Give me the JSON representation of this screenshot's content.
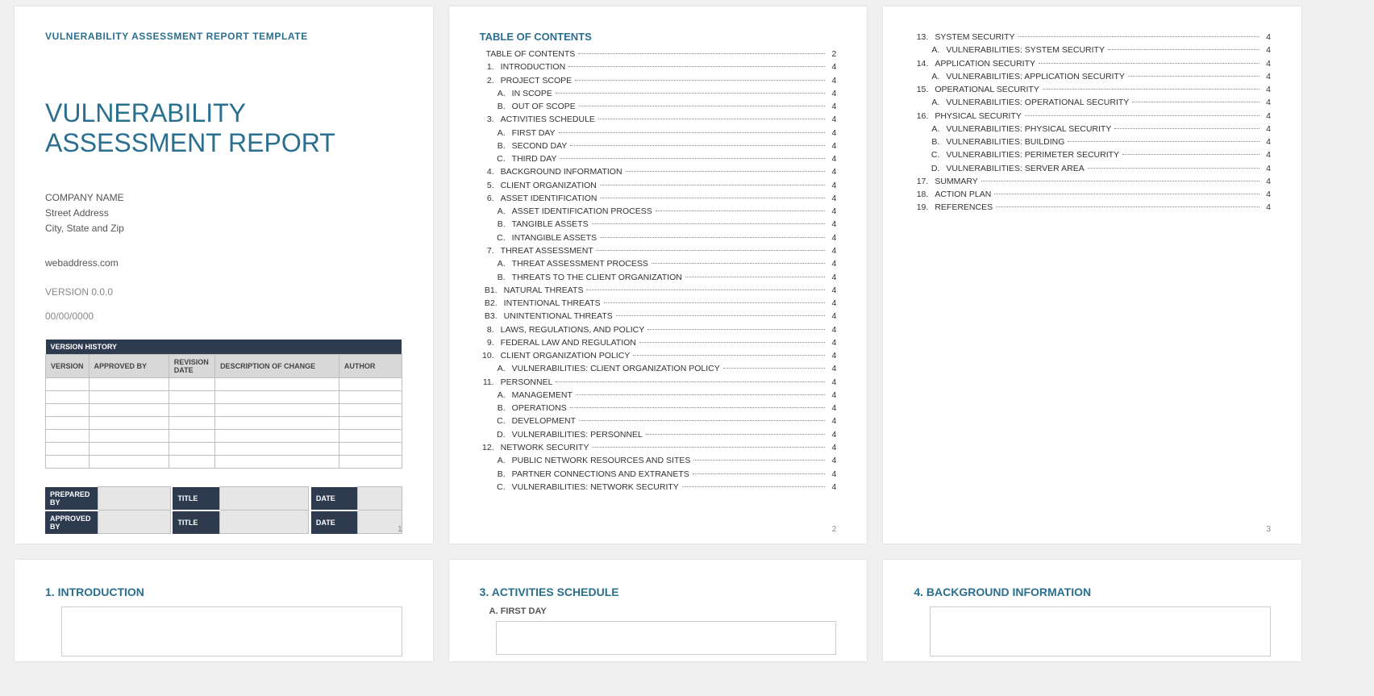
{
  "header": {
    "template_label": "VULNERABILITY ASSESSMENT REPORT TEMPLATE"
  },
  "title_page": {
    "title_line1": "VULNERABILITY",
    "title_line2": "ASSESSMENT REPORT",
    "company_name": "COMPANY NAME",
    "street": "Street Address",
    "city": "City, State and Zip",
    "web": "webaddress.com",
    "version": "VERSION 0.0.0",
    "date": "00/00/0000",
    "version_history": {
      "title": "VERSION HISTORY",
      "cols": [
        "VERSION",
        "APPROVED BY",
        "REVISION DATE",
        "DESCRIPTION OF CHANGE",
        "AUTHOR"
      ]
    },
    "sign": {
      "prepared": "PREPARED BY",
      "approved": "APPROVED BY",
      "title_lbl": "TITLE",
      "date_lbl": "DATE"
    },
    "pnum": "1"
  },
  "toc": {
    "heading": "TABLE OF CONTENTS",
    "page2_pnum": "2",
    "page3_pnum": "3",
    "items_p2": [
      {
        "idx": "",
        "label": "TABLE OF CONTENTS",
        "pg": "2",
        "lvl": 0
      },
      {
        "idx": "1.",
        "label": "INTRODUCTION",
        "pg": "4",
        "lvl": 1
      },
      {
        "idx": "2.",
        "label": "PROJECT SCOPE",
        "pg": "4",
        "lvl": 1
      },
      {
        "idx": "A.",
        "label": "IN SCOPE",
        "pg": "4",
        "lvl": 2
      },
      {
        "idx": "B.",
        "label": "OUT OF SCOPE",
        "pg": "4",
        "lvl": 2
      },
      {
        "idx": "3.",
        "label": "ACTIVITIES SCHEDULE",
        "pg": "4",
        "lvl": 1
      },
      {
        "idx": "A.",
        "label": "FIRST DAY",
        "pg": "4",
        "lvl": 2
      },
      {
        "idx": "B.",
        "label": "SECOND DAY",
        "pg": "4",
        "lvl": 2
      },
      {
        "idx": "C.",
        "label": "THIRD DAY",
        "pg": "4",
        "lvl": 2
      },
      {
        "idx": "4.",
        "label": "BACKGROUND INFORMATION",
        "pg": "4",
        "lvl": 1
      },
      {
        "idx": "5.",
        "label": "CLIENT ORGANIZATION",
        "pg": "4",
        "lvl": 1
      },
      {
        "idx": "6.",
        "label": "ASSET IDENTIFICATION",
        "pg": "4",
        "lvl": 1
      },
      {
        "idx": "A.",
        "label": "ASSET IDENTIFICATION PROCESS",
        "pg": "4",
        "lvl": 2
      },
      {
        "idx": "B.",
        "label": "TANGIBLE ASSETS",
        "pg": "4",
        "lvl": 2
      },
      {
        "idx": "C.",
        "label": "INTANGIBLE ASSETS",
        "pg": "4",
        "lvl": 2
      },
      {
        "idx": "7.",
        "label": "THREAT ASSESSMENT",
        "pg": "4",
        "lvl": 1
      },
      {
        "idx": "A.",
        "label": "THREAT ASSESSMENT PROCESS",
        "pg": "4",
        "lvl": 2
      },
      {
        "idx": "B.",
        "label": "THREATS TO THE CLIENT ORGANIZATION",
        "pg": "4",
        "lvl": 2
      },
      {
        "idx": "B1.",
        "label": "NATURAL THREATS",
        "pg": "4",
        "lvl": 3
      },
      {
        "idx": "B2.",
        "label": "INTENTIONAL THREATS",
        "pg": "4",
        "lvl": 3
      },
      {
        "idx": "B3.",
        "label": "UNINTENTIONAL THREATS",
        "pg": "4",
        "lvl": 3
      },
      {
        "idx": "8.",
        "label": "LAWS, REGULATIONS, AND POLICY",
        "pg": "4",
        "lvl": 1
      },
      {
        "idx": "9.",
        "label": "FEDERAL LAW AND REGULATION",
        "pg": "4",
        "lvl": 1
      },
      {
        "idx": "10.",
        "label": "CLIENT ORGANIZATION POLICY",
        "pg": "4",
        "lvl": 1
      },
      {
        "idx": "A.",
        "label": "VULNERABILITIES: CLIENT ORGANIZATION POLICY",
        "pg": "4",
        "lvl": 2
      },
      {
        "idx": "11.",
        "label": "PERSONNEL",
        "pg": "4",
        "lvl": 1
      },
      {
        "idx": "A.",
        "label": "MANAGEMENT",
        "pg": "4",
        "lvl": 2
      },
      {
        "idx": "B.",
        "label": "OPERATIONS",
        "pg": "4",
        "lvl": 2
      },
      {
        "idx": "C.",
        "label": "DEVELOPMENT",
        "pg": "4",
        "lvl": 2
      },
      {
        "idx": "D.",
        "label": "VULNERABILITIES: PERSONNEL",
        "pg": "4",
        "lvl": 2
      },
      {
        "idx": "12.",
        "label": "NETWORK SECURITY",
        "pg": "4",
        "lvl": 1
      },
      {
        "idx": "A.",
        "label": "PUBLIC NETWORK RESOURCES AND SITES",
        "pg": "4",
        "lvl": 2
      },
      {
        "idx": "B.",
        "label": "PARTNER CONNECTIONS AND EXTRANETS",
        "pg": "4",
        "lvl": 2
      },
      {
        "idx": "C.",
        "label": "VULNERABILITIES: NETWORK SECURITY",
        "pg": "4",
        "lvl": 2
      }
    ],
    "items_p3": [
      {
        "idx": "13.",
        "label": "SYSTEM SECURITY",
        "pg": "4",
        "lvl": 1
      },
      {
        "idx": "A.",
        "label": "VULNERABILITIES: SYSTEM SECURITY",
        "pg": "4",
        "lvl": 2
      },
      {
        "idx": "14.",
        "label": "APPLICATION SECURITY",
        "pg": "4",
        "lvl": 1
      },
      {
        "idx": "A.",
        "label": "VULNERABILITIES: APPLICATION SECURITY",
        "pg": "4",
        "lvl": 2
      },
      {
        "idx": "15.",
        "label": "OPERATIONAL SECURITY",
        "pg": "4",
        "lvl": 1
      },
      {
        "idx": "A.",
        "label": "VULNERABILITIES: OPERATIONAL SECURITY",
        "pg": "4",
        "lvl": 2
      },
      {
        "idx": "16.",
        "label": "PHYSICAL SECURITY",
        "pg": "4",
        "lvl": 1
      },
      {
        "idx": "A.",
        "label": "VULNERABILITIES: PHYSICAL SECURITY",
        "pg": "4",
        "lvl": 2
      },
      {
        "idx": "B.",
        "label": "VULNERABILITIES: BUILDING",
        "pg": "4",
        "lvl": 2
      },
      {
        "idx": "C.",
        "label": "VULNERABILITIES: PERIMETER SECURITY",
        "pg": "4",
        "lvl": 2
      },
      {
        "idx": "D.",
        "label": "VULNERABILITIES: SERVER AREA",
        "pg": "4",
        "lvl": 2
      },
      {
        "idx": "17.",
        "label": "SUMMARY",
        "pg": "4",
        "lvl": 1
      },
      {
        "idx": "18.",
        "label": "ACTION PLAN",
        "pg": "4",
        "lvl": 1
      },
      {
        "idx": "19.",
        "label": "REFERENCES",
        "pg": "4",
        "lvl": 1
      }
    ]
  },
  "sections": {
    "s1": "1. INTRODUCTION",
    "s3": "3. ACTIVITIES SCHEDULE",
    "s3a": "A. FIRST DAY",
    "s4": "4. BACKGROUND INFORMATION"
  }
}
